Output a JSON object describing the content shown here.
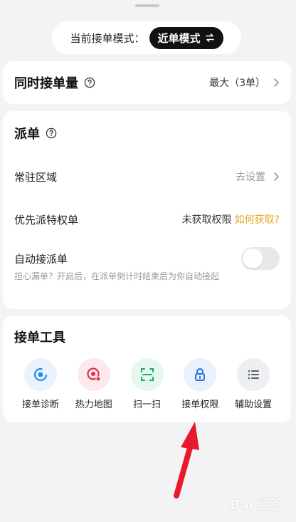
{
  "mode": {
    "label": "当前接单模式：",
    "value": "近单模式"
  },
  "simultaneous": {
    "title": "同时接单量",
    "value": "最大（3单）"
  },
  "dispatch": {
    "title": "派单",
    "resident": {
      "label": "常驻区域",
      "value": "去设置"
    },
    "priority": {
      "label": "优先派特权单",
      "status": "未获取权限",
      "link": "如何获取?"
    },
    "auto": {
      "label": "自动接派单",
      "desc": "担心漏单？开启后，在派单倒计时结束后为你自动接起",
      "enabled": false
    }
  },
  "tools": {
    "title": "接单工具",
    "items": [
      {
        "label": "接单诊断",
        "icon": "diagnosis-icon",
        "bg": "#e8f3fd",
        "color": "#2b8ae6"
      },
      {
        "label": "热力地图",
        "icon": "heatmap-icon",
        "bg": "#fde8ec",
        "color": "#e0344c"
      },
      {
        "label": "扫一扫",
        "icon": "scan-icon",
        "bg": "#e6f7ef",
        "color": "#1aa865"
      },
      {
        "label": "接单权限",
        "icon": "lock-icon",
        "bg": "#e8f1fd",
        "color": "#2b6fdc"
      },
      {
        "label": "辅助设置",
        "icon": "list-icon",
        "bg": "#eeeff2",
        "color": "#5a5f6a"
      }
    ]
  },
  "watermark": "Bai 经验",
  "accent": "#e2a520"
}
